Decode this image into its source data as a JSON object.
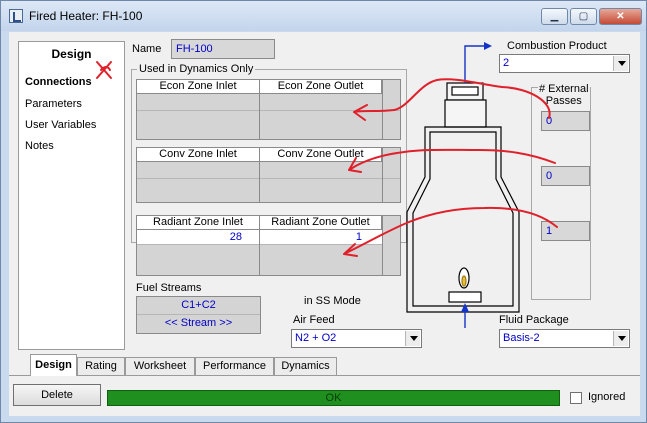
{
  "window": {
    "title": "Fired Heater: FH-100"
  },
  "nav": {
    "header": "Design",
    "items": [
      {
        "label": "Connections"
      },
      {
        "label": "Parameters"
      },
      {
        "label": "User Variables"
      },
      {
        "label": "Notes"
      }
    ]
  },
  "name_field": {
    "label": "Name",
    "value": "FH-100"
  },
  "dynamics_group": {
    "title": "Used in Dynamics Only",
    "econ": {
      "col1": "Econ Zone Inlet",
      "col2": "Econ Zone Outlet"
    },
    "conv": {
      "col1": "Conv Zone Inlet",
      "col2": "Conv Zone Outlet"
    }
  },
  "radiant": {
    "col1": "Radiant Zone Inlet",
    "col2": "Radiant Zone Outlet",
    "inlet_value": "28",
    "outlet_value": "1"
  },
  "fuel_streams": {
    "label": "Fuel Streams",
    "items": [
      "C1+C2",
      "<< Stream >>"
    ]
  },
  "ss_mode_label": "in SS Mode",
  "air_feed": {
    "label": "Air Feed",
    "value": "N2 + O2"
  },
  "combustion_product": {
    "label": "Combustion Product",
    "value": "2"
  },
  "external_passes": {
    "label_line1": "# External",
    "label_line2": "Passes",
    "values": [
      "0",
      "0",
      "1"
    ]
  },
  "fluid_package": {
    "label": "Fluid Package",
    "value": "Basis-2"
  },
  "tabs": [
    "Design",
    "Rating",
    "Worksheet",
    "Performance",
    "Dynamics"
  ],
  "delete_button": "Delete",
  "status_text": "OK",
  "ignored_label": "Ignored",
  "colors": {
    "status_green": "#1f8f1f",
    "value_blue": "#0000c8",
    "annotation_red": "#e0202a",
    "connector_blue": "#1434c8"
  }
}
